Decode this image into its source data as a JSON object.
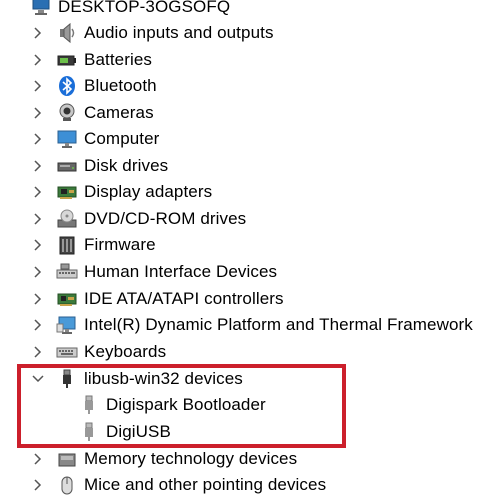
{
  "computer_name": "DESKTOP-3OGSOFQ",
  "colors": {
    "highlight_border": "#cc1f2b",
    "arrow": "#555555"
  },
  "items": [
    {
      "label": "Audio inputs and outputs",
      "icon": "speaker-icon",
      "expanded": false
    },
    {
      "label": "Batteries",
      "icon": "battery-icon",
      "expanded": false
    },
    {
      "label": "Bluetooth",
      "icon": "bluetooth-icon",
      "expanded": false
    },
    {
      "label": "Cameras",
      "icon": "camera-icon",
      "expanded": false
    },
    {
      "label": "Computer",
      "icon": "monitor-icon",
      "expanded": false
    },
    {
      "label": "Disk drives",
      "icon": "disk-drive-icon",
      "expanded": false
    },
    {
      "label": "Display adapters",
      "icon": "display-adapter-icon",
      "expanded": false
    },
    {
      "label": "DVD/CD-ROM drives",
      "icon": "dvd-drive-icon",
      "expanded": false
    },
    {
      "label": "Firmware",
      "icon": "firmware-icon",
      "expanded": false
    },
    {
      "label": "Human Interface Devices",
      "icon": "hid-icon",
      "expanded": false
    },
    {
      "label": "IDE ATA/ATAPI controllers",
      "icon": "ide-controller-icon",
      "expanded": false
    },
    {
      "label": "Intel(R) Dynamic Platform and Thermal Framework",
      "icon": "thermal-framework-icon",
      "expanded": false
    },
    {
      "label": "Keyboards",
      "icon": "keyboard-icon",
      "expanded": false
    },
    {
      "label": "libusb-win32 devices",
      "icon": "usb-plug-icon",
      "expanded": true,
      "children": [
        {
          "label": "Digispark Bootloader",
          "icon": "usb-device-icon"
        },
        {
          "label": "DigiUSB",
          "icon": "usb-device-icon"
        }
      ]
    },
    {
      "label": "Memory technology devices",
      "icon": "memory-device-icon",
      "expanded": false
    },
    {
      "label": "Mice and other pointing devices",
      "icon": "mouse-icon",
      "expanded": false
    }
  ]
}
